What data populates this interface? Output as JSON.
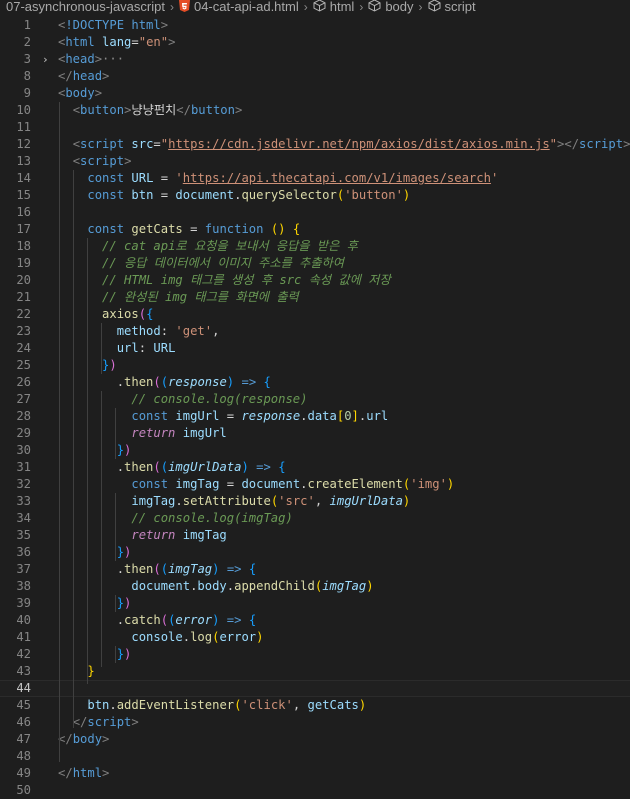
{
  "breadcrumb": {
    "folder": "07-asynchronous-javascript",
    "file": "04-cat-api-ad.html",
    "item1": "html",
    "item2": "body",
    "item3": "script"
  },
  "editor": {
    "current_line": 44,
    "lines": [
      {
        "n": "1",
        "t": [
          [
            "tb",
            "<"
          ],
          [
            "tg",
            "!DOCTYPE html"
          ],
          [
            "tb",
            ">"
          ]
        ]
      },
      {
        "n": "2",
        "t": [
          [
            "tb",
            "<"
          ],
          [
            "tg",
            "html"
          ],
          [
            "tx",
            " "
          ],
          [
            "at",
            "lang"
          ],
          [
            "tx",
            "="
          ],
          [
            "st",
            "\"en\""
          ],
          [
            "tb",
            ">"
          ]
        ]
      },
      {
        "n": "3",
        "fold": true,
        "t": [
          [
            "tb",
            "<"
          ],
          [
            "tg",
            "head"
          ],
          [
            "tb",
            ">"
          ],
          [
            "ell",
            "···"
          ]
        ]
      },
      {
        "n": "8",
        "t": [
          [
            "tb",
            "</"
          ],
          [
            "tg",
            "head"
          ],
          [
            "tb",
            ">"
          ]
        ]
      },
      {
        "n": "9",
        "t": [
          [
            "tb",
            "<"
          ],
          [
            "tg",
            "body"
          ],
          [
            "tb",
            ">"
          ]
        ]
      },
      {
        "n": "10",
        "t": [
          [
            "tx",
            "  "
          ],
          [
            "tb",
            "<"
          ],
          [
            "tg",
            "button"
          ],
          [
            "tb",
            ">"
          ],
          [
            "tx",
            "냥냥펀치"
          ],
          [
            "tb",
            "</"
          ],
          [
            "tg",
            "button"
          ],
          [
            "tb",
            ">"
          ]
        ]
      },
      {
        "n": "11",
        "t": []
      },
      {
        "n": "12",
        "t": [
          [
            "tx",
            "  "
          ],
          [
            "tb",
            "<"
          ],
          [
            "tg",
            "script"
          ],
          [
            "tx",
            " "
          ],
          [
            "at",
            "src"
          ],
          [
            "tx",
            "="
          ],
          [
            "st",
            "\""
          ],
          [
            "url",
            "https://cdn.jsdelivr.net/npm/axios/dist/axios.min.js"
          ],
          [
            "st",
            "\""
          ],
          [
            "tb",
            "></"
          ],
          [
            "tg",
            "script"
          ],
          [
            "tb",
            ">"
          ]
        ]
      },
      {
        "n": "13",
        "t": [
          [
            "tx",
            "  "
          ],
          [
            "tb",
            "<"
          ],
          [
            "tg",
            "script"
          ],
          [
            "tb",
            ">"
          ]
        ]
      },
      {
        "n": "14",
        "t": [
          [
            "tx",
            "    "
          ],
          [
            "tg",
            "const"
          ],
          [
            "tx",
            " "
          ],
          [
            "at",
            "URL"
          ],
          [
            "tx",
            " = "
          ],
          [
            "st",
            "'"
          ],
          [
            "url",
            "https://api.thecatapi.com/v1/images/search"
          ],
          [
            "st",
            "'"
          ]
        ]
      },
      {
        "n": "15",
        "t": [
          [
            "tx",
            "    "
          ],
          [
            "tg",
            "const"
          ],
          [
            "tx",
            " "
          ],
          [
            "at",
            "btn"
          ],
          [
            "tx",
            " = "
          ],
          [
            "at",
            "document"
          ],
          [
            "tx",
            "."
          ],
          [
            "fn",
            "querySelector"
          ],
          [
            "b1",
            "("
          ],
          [
            "st",
            "'button'"
          ],
          [
            "b1",
            ")"
          ]
        ]
      },
      {
        "n": "16",
        "t": []
      },
      {
        "n": "17",
        "t": [
          [
            "tx",
            "    "
          ],
          [
            "tg",
            "const"
          ],
          [
            "tx",
            " "
          ],
          [
            "fn",
            "getCats"
          ],
          [
            "tx",
            " = "
          ],
          [
            "tg",
            "function"
          ],
          [
            "tx",
            " "
          ],
          [
            "b1",
            "()"
          ],
          [
            "tx",
            " "
          ],
          [
            "b1",
            "{"
          ]
        ]
      },
      {
        "n": "18",
        "t": [
          [
            "tx",
            "      "
          ],
          [
            "cm",
            "// cat api로 요청을 보내서 응답을 받은 후"
          ]
        ]
      },
      {
        "n": "19",
        "t": [
          [
            "tx",
            "      "
          ],
          [
            "cm",
            "// 응답 데이터에서 이미지 주소를 추출하여"
          ]
        ]
      },
      {
        "n": "20",
        "t": [
          [
            "tx",
            "      "
          ],
          [
            "cm",
            "// HTML img 태그를 생성 후 src 속성 값에 저장"
          ]
        ]
      },
      {
        "n": "21",
        "t": [
          [
            "tx",
            "      "
          ],
          [
            "cm",
            "// 완성된 img 태그를 화면에 출력"
          ]
        ]
      },
      {
        "n": "22",
        "t": [
          [
            "tx",
            "      "
          ],
          [
            "fn",
            "axios"
          ],
          [
            "b2",
            "("
          ],
          [
            "b3",
            "{"
          ]
        ]
      },
      {
        "n": "23",
        "t": [
          [
            "tx",
            "        "
          ],
          [
            "pr",
            "method"
          ],
          [
            "tx",
            ": "
          ],
          [
            "st",
            "'get'"
          ],
          [
            "tx",
            ","
          ]
        ]
      },
      {
        "n": "24",
        "t": [
          [
            "tx",
            "        "
          ],
          [
            "pr",
            "url"
          ],
          [
            "tx",
            ": "
          ],
          [
            "at",
            "URL"
          ]
        ]
      },
      {
        "n": "25",
        "t": [
          [
            "tx",
            "      "
          ],
          [
            "b3",
            "}"
          ],
          [
            "b2",
            ")"
          ]
        ]
      },
      {
        "n": "26",
        "t": [
          [
            "tx",
            "        ."
          ],
          [
            "fn",
            "then"
          ],
          [
            "b2",
            "("
          ],
          [
            "b3",
            "("
          ],
          [
            "pm",
            "response"
          ],
          [
            "b3",
            ")"
          ],
          [
            "tx",
            " "
          ],
          [
            "tg",
            "=>"
          ],
          [
            "tx",
            " "
          ],
          [
            "b3",
            "{"
          ]
        ]
      },
      {
        "n": "27",
        "t": [
          [
            "tx",
            "          "
          ],
          [
            "cm",
            "// console.log(response)"
          ]
        ]
      },
      {
        "n": "28",
        "t": [
          [
            "tx",
            "          "
          ],
          [
            "tg",
            "const"
          ],
          [
            "tx",
            " "
          ],
          [
            "at",
            "imgUrl"
          ],
          [
            "tx",
            " = "
          ],
          [
            "pm",
            "response"
          ],
          [
            "tx",
            "."
          ],
          [
            "pr",
            "data"
          ],
          [
            "b1",
            "["
          ],
          [
            "nm",
            "0"
          ],
          [
            "b1",
            "]"
          ],
          [
            "tx",
            "."
          ],
          [
            "pr",
            "url"
          ]
        ]
      },
      {
        "n": "29",
        "t": [
          [
            "tx",
            "          "
          ],
          [
            "rt",
            "return"
          ],
          [
            "tx",
            " "
          ],
          [
            "at",
            "imgUrl"
          ]
        ]
      },
      {
        "n": "30",
        "t": [
          [
            "tx",
            "        "
          ],
          [
            "b3",
            "}"
          ],
          [
            "b2",
            ")"
          ]
        ]
      },
      {
        "n": "31",
        "t": [
          [
            "tx",
            "        ."
          ],
          [
            "fn",
            "then"
          ],
          [
            "b2",
            "("
          ],
          [
            "b3",
            "("
          ],
          [
            "pm",
            "imgUrlData"
          ],
          [
            "b3",
            ")"
          ],
          [
            "tx",
            " "
          ],
          [
            "tg",
            "=>"
          ],
          [
            "tx",
            " "
          ],
          [
            "b3",
            "{"
          ]
        ]
      },
      {
        "n": "32",
        "t": [
          [
            "tx",
            "          "
          ],
          [
            "tg",
            "const"
          ],
          [
            "tx",
            " "
          ],
          [
            "at",
            "imgTag"
          ],
          [
            "tx",
            " = "
          ],
          [
            "at",
            "document"
          ],
          [
            "tx",
            "."
          ],
          [
            "fn",
            "createElement"
          ],
          [
            "b1",
            "("
          ],
          [
            "st",
            "'img'"
          ],
          [
            "b1",
            ")"
          ]
        ]
      },
      {
        "n": "33",
        "t": [
          [
            "tx",
            "          "
          ],
          [
            "at",
            "imgTag"
          ],
          [
            "tx",
            "."
          ],
          [
            "fn",
            "setAttribute"
          ],
          [
            "b1",
            "("
          ],
          [
            "st",
            "'src'"
          ],
          [
            "tx",
            ", "
          ],
          [
            "pm",
            "imgUrlData"
          ],
          [
            "b1",
            ")"
          ]
        ]
      },
      {
        "n": "34",
        "t": [
          [
            "tx",
            "          "
          ],
          [
            "cm",
            "// console.log(imgTag)"
          ]
        ]
      },
      {
        "n": "35",
        "t": [
          [
            "tx",
            "          "
          ],
          [
            "rt",
            "return"
          ],
          [
            "tx",
            " "
          ],
          [
            "at",
            "imgTag"
          ]
        ]
      },
      {
        "n": "36",
        "t": [
          [
            "tx",
            "        "
          ],
          [
            "b3",
            "}"
          ],
          [
            "b2",
            ")"
          ]
        ]
      },
      {
        "n": "37",
        "t": [
          [
            "tx",
            "        ."
          ],
          [
            "fn",
            "then"
          ],
          [
            "b2",
            "("
          ],
          [
            "b3",
            "("
          ],
          [
            "pm",
            "imgTag"
          ],
          [
            "b3",
            ")"
          ],
          [
            "tx",
            " "
          ],
          [
            "tg",
            "=>"
          ],
          [
            "tx",
            " "
          ],
          [
            "b3",
            "{"
          ]
        ]
      },
      {
        "n": "38",
        "t": [
          [
            "tx",
            "          "
          ],
          [
            "at",
            "document"
          ],
          [
            "tx",
            "."
          ],
          [
            "pr",
            "body"
          ],
          [
            "tx",
            "."
          ],
          [
            "fn",
            "appendChild"
          ],
          [
            "b1",
            "("
          ],
          [
            "pm",
            "imgTag"
          ],
          [
            "b1",
            ")"
          ]
        ]
      },
      {
        "n": "39",
        "t": [
          [
            "tx",
            "        "
          ],
          [
            "b3",
            "}"
          ],
          [
            "b2",
            ")"
          ]
        ]
      },
      {
        "n": "40",
        "t": [
          [
            "tx",
            "        ."
          ],
          [
            "fn",
            "catch"
          ],
          [
            "b2",
            "("
          ],
          [
            "b3",
            "("
          ],
          [
            "pm",
            "error"
          ],
          [
            "b3",
            ")"
          ],
          [
            "tx",
            " "
          ],
          [
            "tg",
            "=>"
          ],
          [
            "tx",
            " "
          ],
          [
            "b3",
            "{"
          ]
        ]
      },
      {
        "n": "41",
        "t": [
          [
            "tx",
            "          "
          ],
          [
            "at",
            "console"
          ],
          [
            "tx",
            "."
          ],
          [
            "fn",
            "log"
          ],
          [
            "b1",
            "("
          ],
          [
            "at",
            "error"
          ],
          [
            "b1",
            ")"
          ]
        ]
      },
      {
        "n": "42",
        "t": [
          [
            "tx",
            "        "
          ],
          [
            "b3",
            "}"
          ],
          [
            "b2",
            ")"
          ]
        ]
      },
      {
        "n": "43",
        "t": [
          [
            "tx",
            "    "
          ],
          [
            "b1",
            "}"
          ]
        ]
      },
      {
        "n": "44",
        "t": []
      },
      {
        "n": "45",
        "t": [
          [
            "tx",
            "    "
          ],
          [
            "at",
            "btn"
          ],
          [
            "tx",
            "."
          ],
          [
            "fn",
            "addEventListener"
          ],
          [
            "b1",
            "("
          ],
          [
            "st",
            "'click'"
          ],
          [
            "tx",
            ", "
          ],
          [
            "at",
            "getCats"
          ],
          [
            "b1",
            ")"
          ]
        ]
      },
      {
        "n": "46",
        "t": [
          [
            "tx",
            "  "
          ],
          [
            "tb",
            "</"
          ],
          [
            "tg",
            "script"
          ],
          [
            "tb",
            ">"
          ]
        ]
      },
      {
        "n": "47",
        "t": [
          [
            "tb",
            "</"
          ],
          [
            "tg",
            "body"
          ],
          [
            "tb",
            ">"
          ]
        ]
      },
      {
        "n": "48",
        "t": []
      },
      {
        "n": "49",
        "t": [
          [
            "tb",
            "</"
          ],
          [
            "tg",
            "html"
          ],
          [
            "tb",
            ">"
          ]
        ]
      },
      {
        "n": "50",
        "t": []
      }
    ]
  }
}
